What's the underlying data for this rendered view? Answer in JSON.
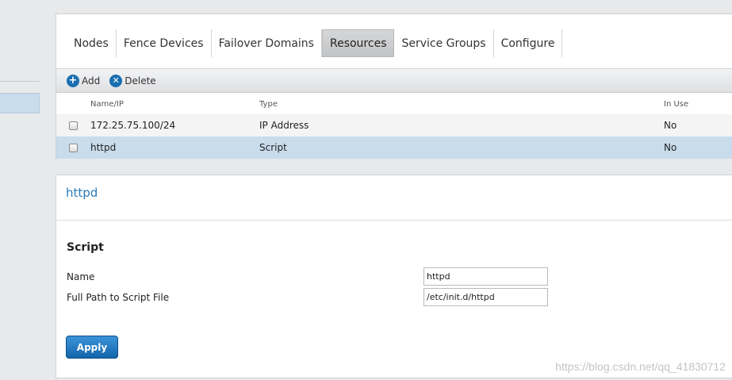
{
  "tabs": [
    {
      "label": "Nodes"
    },
    {
      "label": "Fence Devices"
    },
    {
      "label": "Failover Domains"
    },
    {
      "label": "Resources",
      "active": true
    },
    {
      "label": "Service Groups"
    },
    {
      "label": "Configure"
    }
  ],
  "toolbar": {
    "add_label": "Add",
    "delete_label": "Delete",
    "add_icon": "plus-circle-icon",
    "delete_icon": "x-circle-icon"
  },
  "table": {
    "columns": [
      "Name/IP",
      "Type",
      "In Use"
    ],
    "rows": [
      {
        "name": "172.25.75.100/24",
        "type": "IP Address",
        "in_use": "No"
      },
      {
        "name": "httpd",
        "type": "Script",
        "in_use": "No",
        "selected": true
      }
    ]
  },
  "detail": {
    "title": "httpd",
    "section": "Script",
    "fields": [
      {
        "label": "Name",
        "value": "httpd"
      },
      {
        "label": "Full Path to Script File",
        "value": "/etc/init.d/httpd"
      }
    ],
    "apply_label": "Apply"
  },
  "watermark": "https://blog.csdn.net/qq_41830712",
  "colors": {
    "accent": "#2a7ab8",
    "selected_row": "#c8dcec",
    "button": "#1a6fb0"
  }
}
